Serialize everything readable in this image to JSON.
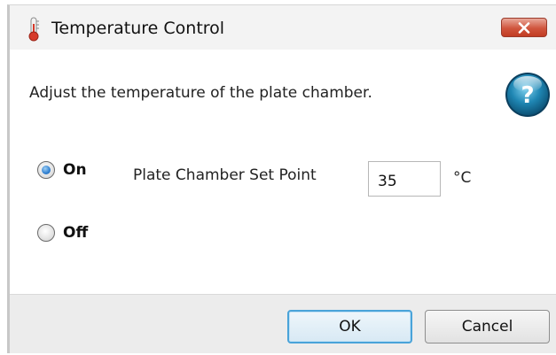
{
  "window": {
    "title": "Temperature Control"
  },
  "icons": {
    "title_icon": "thermometer-icon",
    "close": "close-icon",
    "help": "help-icon"
  },
  "colors": {
    "close_button": "#c84a2f",
    "help_button": "#1e7fa8",
    "default_button_border": "#49a3d9",
    "radio_selected": "#2f7fd0"
  },
  "main": {
    "instruction": "Adjust the temperature of the plate chamber.",
    "power": {
      "options": [
        {
          "label": "On",
          "checked": true
        },
        {
          "label": "Off",
          "checked": false
        }
      ],
      "selected": "On"
    },
    "setpoint": {
      "label": "Plate Chamber Set Point",
      "value": "35",
      "unit": "°C"
    }
  },
  "footer": {
    "ok_label": "OK",
    "cancel_label": "Cancel"
  }
}
